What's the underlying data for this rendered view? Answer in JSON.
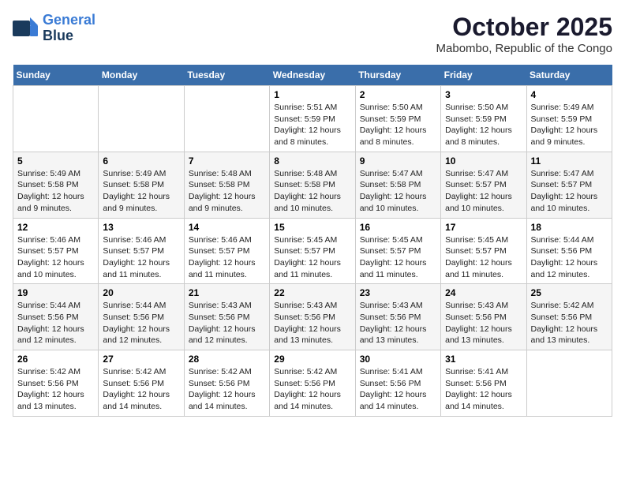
{
  "logo": {
    "line1": "General",
    "line2": "Blue"
  },
  "title": "October 2025",
  "location": "Mabombo, Republic of the Congo",
  "weekdays": [
    "Sunday",
    "Monday",
    "Tuesday",
    "Wednesday",
    "Thursday",
    "Friday",
    "Saturday"
  ],
  "weeks": [
    [
      {
        "day": "",
        "info": ""
      },
      {
        "day": "",
        "info": ""
      },
      {
        "day": "",
        "info": ""
      },
      {
        "day": "1",
        "info": "Sunrise: 5:51 AM\nSunset: 5:59 PM\nDaylight: 12 hours\nand 8 minutes."
      },
      {
        "day": "2",
        "info": "Sunrise: 5:50 AM\nSunset: 5:59 PM\nDaylight: 12 hours\nand 8 minutes."
      },
      {
        "day": "3",
        "info": "Sunrise: 5:50 AM\nSunset: 5:59 PM\nDaylight: 12 hours\nand 8 minutes."
      },
      {
        "day": "4",
        "info": "Sunrise: 5:49 AM\nSunset: 5:59 PM\nDaylight: 12 hours\nand 9 minutes."
      }
    ],
    [
      {
        "day": "5",
        "info": "Sunrise: 5:49 AM\nSunset: 5:58 PM\nDaylight: 12 hours\nand 9 minutes."
      },
      {
        "day": "6",
        "info": "Sunrise: 5:49 AM\nSunset: 5:58 PM\nDaylight: 12 hours\nand 9 minutes."
      },
      {
        "day": "7",
        "info": "Sunrise: 5:48 AM\nSunset: 5:58 PM\nDaylight: 12 hours\nand 9 minutes."
      },
      {
        "day": "8",
        "info": "Sunrise: 5:48 AM\nSunset: 5:58 PM\nDaylight: 12 hours\nand 10 minutes."
      },
      {
        "day": "9",
        "info": "Sunrise: 5:47 AM\nSunset: 5:58 PM\nDaylight: 12 hours\nand 10 minutes."
      },
      {
        "day": "10",
        "info": "Sunrise: 5:47 AM\nSunset: 5:57 PM\nDaylight: 12 hours\nand 10 minutes."
      },
      {
        "day": "11",
        "info": "Sunrise: 5:47 AM\nSunset: 5:57 PM\nDaylight: 12 hours\nand 10 minutes."
      }
    ],
    [
      {
        "day": "12",
        "info": "Sunrise: 5:46 AM\nSunset: 5:57 PM\nDaylight: 12 hours\nand 10 minutes."
      },
      {
        "day": "13",
        "info": "Sunrise: 5:46 AM\nSunset: 5:57 PM\nDaylight: 12 hours\nand 11 minutes."
      },
      {
        "day": "14",
        "info": "Sunrise: 5:46 AM\nSunset: 5:57 PM\nDaylight: 12 hours\nand 11 minutes."
      },
      {
        "day": "15",
        "info": "Sunrise: 5:45 AM\nSunset: 5:57 PM\nDaylight: 12 hours\nand 11 minutes."
      },
      {
        "day": "16",
        "info": "Sunrise: 5:45 AM\nSunset: 5:57 PM\nDaylight: 12 hours\nand 11 minutes."
      },
      {
        "day": "17",
        "info": "Sunrise: 5:45 AM\nSunset: 5:57 PM\nDaylight: 12 hours\nand 11 minutes."
      },
      {
        "day": "18",
        "info": "Sunrise: 5:44 AM\nSunset: 5:56 PM\nDaylight: 12 hours\nand 12 minutes."
      }
    ],
    [
      {
        "day": "19",
        "info": "Sunrise: 5:44 AM\nSunset: 5:56 PM\nDaylight: 12 hours\nand 12 minutes."
      },
      {
        "day": "20",
        "info": "Sunrise: 5:44 AM\nSunset: 5:56 PM\nDaylight: 12 hours\nand 12 minutes."
      },
      {
        "day": "21",
        "info": "Sunrise: 5:43 AM\nSunset: 5:56 PM\nDaylight: 12 hours\nand 12 minutes."
      },
      {
        "day": "22",
        "info": "Sunrise: 5:43 AM\nSunset: 5:56 PM\nDaylight: 12 hours\nand 13 minutes."
      },
      {
        "day": "23",
        "info": "Sunrise: 5:43 AM\nSunset: 5:56 PM\nDaylight: 12 hours\nand 13 minutes."
      },
      {
        "day": "24",
        "info": "Sunrise: 5:43 AM\nSunset: 5:56 PM\nDaylight: 12 hours\nand 13 minutes."
      },
      {
        "day": "25",
        "info": "Sunrise: 5:42 AM\nSunset: 5:56 PM\nDaylight: 12 hours\nand 13 minutes."
      }
    ],
    [
      {
        "day": "26",
        "info": "Sunrise: 5:42 AM\nSunset: 5:56 PM\nDaylight: 12 hours\nand 13 minutes."
      },
      {
        "day": "27",
        "info": "Sunrise: 5:42 AM\nSunset: 5:56 PM\nDaylight: 12 hours\nand 14 minutes."
      },
      {
        "day": "28",
        "info": "Sunrise: 5:42 AM\nSunset: 5:56 PM\nDaylight: 12 hours\nand 14 minutes."
      },
      {
        "day": "29",
        "info": "Sunrise: 5:42 AM\nSunset: 5:56 PM\nDaylight: 12 hours\nand 14 minutes."
      },
      {
        "day": "30",
        "info": "Sunrise: 5:41 AM\nSunset: 5:56 PM\nDaylight: 12 hours\nand 14 minutes."
      },
      {
        "day": "31",
        "info": "Sunrise: 5:41 AM\nSunset: 5:56 PM\nDaylight: 12 hours\nand 14 minutes."
      },
      {
        "day": "",
        "info": ""
      }
    ]
  ]
}
